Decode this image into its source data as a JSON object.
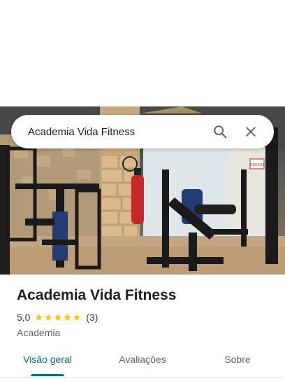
{
  "search": {
    "query": "Academia Vida Fitness",
    "search_icon": "search-icon",
    "clear_icon": "close-icon"
  },
  "photo": {
    "sign_text": "PERIGO"
  },
  "place": {
    "name": "Academia Vida Fitness",
    "rating": "5,0",
    "stars": 5,
    "review_count": "(3)",
    "category": "Academia"
  },
  "tabs": [
    {
      "label": "Visão geral",
      "active": true
    },
    {
      "label": "Avaliações",
      "active": false
    },
    {
      "label": "Sobre",
      "active": false
    }
  ],
  "colors": {
    "accent": "#00796b",
    "star": "#fbbc04",
    "text": "#202124",
    "secondary_text": "#5f6368"
  }
}
